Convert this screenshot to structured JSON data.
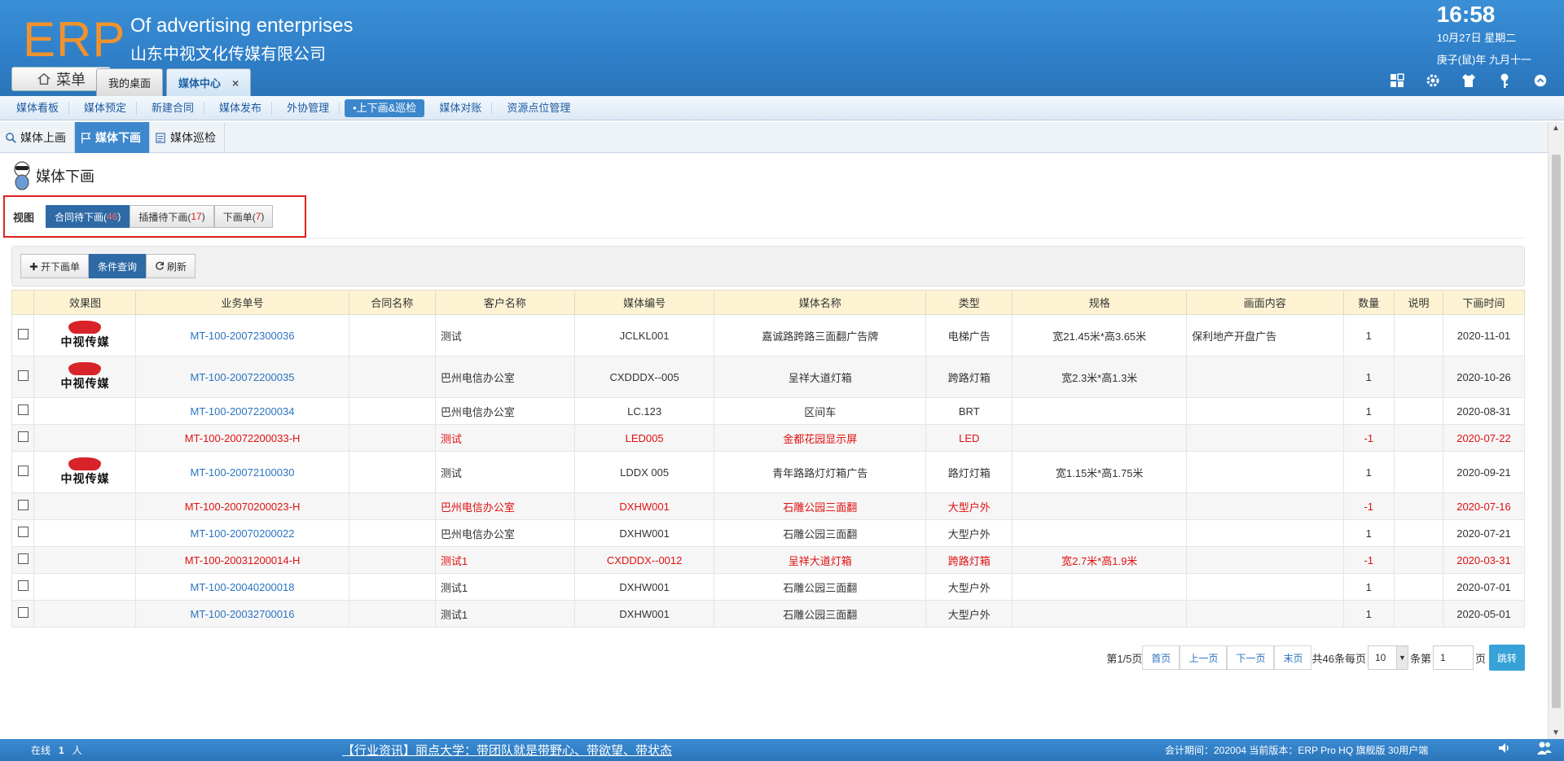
{
  "header": {
    "logo": "ERP",
    "company_en": "Of advertising enterprises",
    "company_cn": "山东中视文化传媒有限公司",
    "time": "16:58",
    "date": "10月27日 星期二",
    "lunar": "庚子(鼠)年 九月十一",
    "menu_label": "菜单",
    "tabs": [
      {
        "label": "我的桌面"
      },
      {
        "label": "媒体中心",
        "close": "×"
      }
    ]
  },
  "nav": {
    "items": [
      "媒体看板",
      "媒体预定",
      "新建合同",
      "媒体发布",
      "外协管理",
      "•上下画&巡检",
      "媒体对账",
      "资源点位管理"
    ]
  },
  "subtabs": [
    "媒体上画",
    "媒体下画",
    "媒体巡检"
  ],
  "page": {
    "title": "媒体下画",
    "view_label": "视图",
    "views": [
      {
        "label": "合同待下画(",
        "count": "46",
        "suffix": ")"
      },
      {
        "label": "插播待下画(",
        "count": "17",
        "suffix": ")"
      },
      {
        "label": "下画单(",
        "count": "7",
        "suffix": ")"
      }
    ],
    "toolbar": [
      "开下画单",
      "条件查询",
      "刷新"
    ]
  },
  "table": {
    "headers": [
      "",
      "效果图",
      "业务单号",
      "合同名称",
      "客户名称",
      "媒体编号",
      "媒体名称",
      "类型",
      "规格",
      "画面内容",
      "数量",
      "说明",
      "下画时间"
    ],
    "logo_text": "中视传媒",
    "rows": [
      {
        "img": true,
        "no": "MT-100-20072300036",
        "contract": "",
        "customer": "测试",
        "code": "JCLKL001",
        "name": "嘉诚路跨路三面翻广告牌",
        "type": "电梯广告",
        "spec": "宽21.45米*高3.65米",
        "content": "保利地产开盘广告",
        "qty": "1",
        "note": "",
        "date": "2020-11-01",
        "red": false
      },
      {
        "img": true,
        "no": "MT-100-20072200035",
        "contract": "",
        "customer": "巴州电信办公室",
        "code": "CXDDDX--005",
        "name": "呈祥大道灯箱",
        "type": "跨路灯箱",
        "spec": "宽2.3米*高1.3米",
        "content": "",
        "qty": "1",
        "note": "",
        "date": "2020-10-26",
        "red": false
      },
      {
        "img": false,
        "no": "MT-100-20072200034",
        "contract": "",
        "customer": "巴州电信办公室",
        "code": "LC.123",
        "name": "区间车",
        "type": "BRT",
        "spec": "",
        "content": "",
        "qty": "1",
        "note": "",
        "date": "2020-08-31",
        "red": false
      },
      {
        "img": false,
        "no": "MT-100-20072200033-H",
        "contract": "",
        "customer": "测试",
        "code": "LED005",
        "name": "金都花园显示屏",
        "type": "LED",
        "spec": "",
        "content": "",
        "qty": "-1",
        "note": "",
        "date": "2020-07-22",
        "red": true
      },
      {
        "img": true,
        "no": "MT-100-20072100030",
        "contract": "",
        "customer": "测试",
        "code": "LDDX 005",
        "name": "青年路路灯灯箱广告",
        "type": "路灯灯箱",
        "spec": "宽1.15米*高1.75米",
        "content": "",
        "qty": "1",
        "note": "",
        "date": "2020-09-21",
        "red": false
      },
      {
        "img": false,
        "no": "MT-100-20070200023-H",
        "contract": "",
        "customer": "巴州电信办公室",
        "code": "DXHW001",
        "name": "石雕公园三面翻",
        "type": "大型户外",
        "spec": "",
        "content": "",
        "qty": "-1",
        "note": "",
        "date": "2020-07-16",
        "red": true
      },
      {
        "img": false,
        "no": "MT-100-20070200022",
        "contract": "",
        "customer": "巴州电信办公室",
        "code": "DXHW001",
        "name": "石雕公园三面翻",
        "type": "大型户外",
        "spec": "",
        "content": "",
        "qty": "1",
        "note": "",
        "date": "2020-07-21",
        "red": false
      },
      {
        "img": false,
        "no": "MT-100-20031200014-H",
        "contract": "",
        "customer": "测试1",
        "code": "CXDDDX--0012",
        "name": "呈祥大道灯箱",
        "type": "跨路灯箱",
        "spec": "宽2.7米*高1.9米",
        "content": "",
        "qty": "-1",
        "note": "",
        "date": "2020-03-31",
        "red": true
      },
      {
        "img": false,
        "no": "MT-100-20040200018",
        "contract": "",
        "customer": "测试1",
        "code": "DXHW001",
        "name": "石雕公园三面翻",
        "type": "大型户外",
        "spec": "",
        "content": "",
        "qty": "1",
        "note": "",
        "date": "2020-07-01",
        "red": false
      },
      {
        "img": false,
        "no": "MT-100-20032700016",
        "contract": "",
        "customer": "测试1",
        "code": "DXHW001",
        "name": "石雕公园三面翻",
        "type": "大型户外",
        "spec": "",
        "content": "",
        "qty": "1",
        "note": "",
        "date": "2020-05-01",
        "red": false
      }
    ]
  },
  "pager": {
    "page_info": "第1/5页",
    "first": "首页",
    "prev": "上一页",
    "next": "下一页",
    "last": "末页",
    "total_text": "共46条每页",
    "per_page": "10",
    "unit_text": "条第",
    "page_input": "1",
    "page_suffix": "页",
    "go": "跳转"
  },
  "footer": {
    "online_label": "在线",
    "online_count": "1",
    "online_unit": "人",
    "news": "【行业资讯】丽点大学：带团队就是带野心、带欲望、带状态",
    "period": "会计期间：202004 当前版本：ERP Pro HQ 旗舰版 30用户端"
  },
  "colors": {
    "header_blue": "#2f7fc8",
    "logo_orange": "#f0922e",
    "link_blue": "#2b74c0",
    "alert_red": "#e01010",
    "highlight_box": "#e02020"
  }
}
